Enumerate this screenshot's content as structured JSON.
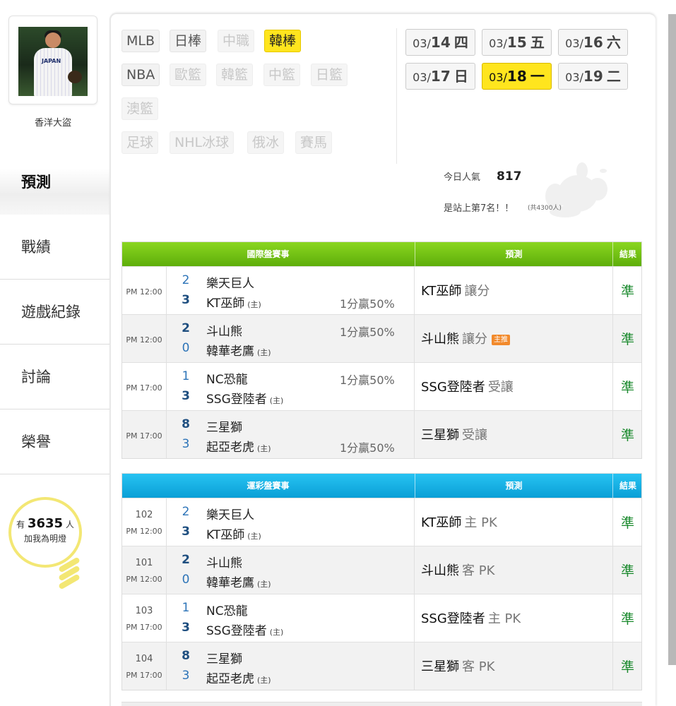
{
  "user": {
    "name": "香洋大盜"
  },
  "nav": [
    {
      "label": "預測",
      "active": true
    },
    {
      "label": "戰績"
    },
    {
      "label": "遊戲紀錄"
    },
    {
      "label": "討論"
    },
    {
      "label": "榮譽"
    }
  ],
  "fans": {
    "prefix": "有",
    "count": "3635",
    "suffix": "人",
    "cta": "加我為明燈"
  },
  "sports": {
    "row1": [
      "MLB",
      "日棒",
      "中職",
      "韓棒"
    ],
    "row2": [
      "NBA",
      "歐籃",
      "韓籃",
      "中籃",
      "日籃"
    ],
    "row3": [
      "澳籃"
    ],
    "row4": [
      "足球",
      "NHL冰球",
      "俄冰",
      "賽馬"
    ],
    "selected": "韓棒"
  },
  "dates": [
    {
      "md": "03/",
      "d": "14",
      "w": "四"
    },
    {
      "md": "03/",
      "d": "15",
      "w": "五"
    },
    {
      "md": "03/",
      "d": "16",
      "w": "六"
    },
    {
      "md": "03/",
      "d": "17",
      "w": "日"
    },
    {
      "md": "03/",
      "d": "18",
      "w": "一",
      "selected": true
    },
    {
      "md": "03/",
      "d": "19",
      "w": "二"
    }
  ],
  "popularity": {
    "label": "今日人氣",
    "count": "817",
    "rank_text": "是站上第7名！！",
    "total": "(共4300人)"
  },
  "intl": {
    "header": {
      "matches": "國際盤賽事",
      "prediction": "預測",
      "result": "結果"
    },
    "rows": [
      {
        "time": "PM 12:00",
        "away": {
          "score": "2",
          "team": "樂天巨人"
        },
        "home": {
          "score": "3",
          "team": "KT巫師",
          "mark": "(主)"
        },
        "line": "1分贏50%",
        "line_on": "home",
        "pick": "KT巫師",
        "pick_note": "讓分",
        "tag": "",
        "result": "準"
      },
      {
        "time": "PM 12:00",
        "away": {
          "score": "2",
          "team": "斗山熊"
        },
        "home": {
          "score": "0",
          "team": "韓華老鷹",
          "mark": "(主)"
        },
        "line": "1分贏50%",
        "line_on": "away",
        "pick": "斗山熊",
        "pick_note": "讓分",
        "tag": "主推",
        "result": "準"
      },
      {
        "time": "PM 17:00",
        "away": {
          "score": "1",
          "team": "NC恐龍"
        },
        "home": {
          "score": "3",
          "team": "SSG登陸者",
          "mark": "(主)"
        },
        "line": "1分贏50%",
        "line_on": "away",
        "pick": "SSG登陸者",
        "pick_note": "受讓",
        "tag": "",
        "result": "準"
      },
      {
        "time": "PM 17:00",
        "away": {
          "score": "8",
          "team": "三星獅"
        },
        "home": {
          "score": "3",
          "team": "起亞老虎",
          "mark": "(主)"
        },
        "line": "1分贏50%",
        "line_on": "home",
        "pick": "三星獅",
        "pick_note": "受讓",
        "tag": "",
        "result": "準"
      }
    ]
  },
  "sportslottery": {
    "header": {
      "matches": "運彩盤賽事",
      "prediction": "預測",
      "result": "結果"
    },
    "rows": [
      {
        "no": "102",
        "time": "PM 12:00",
        "away": {
          "score": "2",
          "team": "樂天巨人"
        },
        "home": {
          "score": "3",
          "team": "KT巫師",
          "mark": "(主)"
        },
        "pick": "KT巫師",
        "pick_note": "主 PK",
        "result": "準"
      },
      {
        "no": "101",
        "time": "PM 12:00",
        "away": {
          "score": "2",
          "team": "斗山熊"
        },
        "home": {
          "score": "0",
          "team": "韓華老鷹",
          "mark": "(主)"
        },
        "pick": "斗山熊",
        "pick_note": "客 PK",
        "result": "準"
      },
      {
        "no": "103",
        "time": "PM 17:00",
        "away": {
          "score": "1",
          "team": "NC恐龍"
        },
        "home": {
          "score": "3",
          "team": "SSG登陸者",
          "mark": "(主)"
        },
        "pick": "SSG登陸者",
        "pick_note": "主 PK",
        "result": "準"
      },
      {
        "no": "104",
        "time": "PM 17:00",
        "away": {
          "score": "8",
          "team": "三星獅"
        },
        "home": {
          "score": "3",
          "team": "起亞老虎",
          "mark": "(主)"
        },
        "pick": "三星獅",
        "pick_note": "客 PK",
        "result": "準"
      }
    ]
  }
}
